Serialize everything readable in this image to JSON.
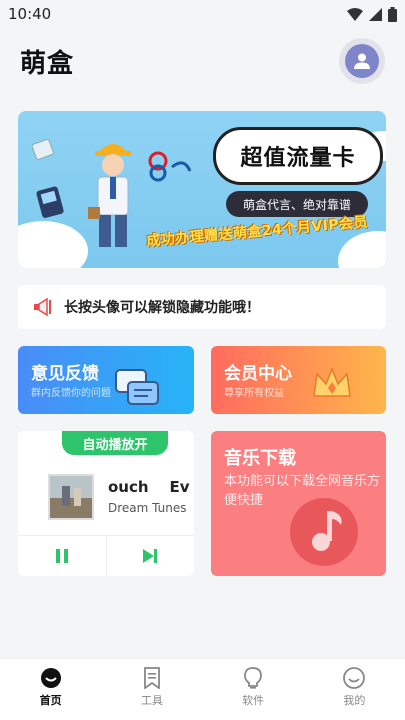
{
  "status": {
    "time": "10:40",
    "icons": [
      "wifi-icon",
      "signal-icon",
      "battery-icon"
    ]
  },
  "header": {
    "title": "萌盒",
    "avatar_icon": "person-icon"
  },
  "banner": {
    "title": "超值流量卡",
    "subtitle": "萌盒代言、绝对靠谱",
    "promo": "成功办理赠送萌盒24个月VIP会员"
  },
  "notice": {
    "icon": "megaphone-icon",
    "text": "长按头像可以解锁隐藏功能哦！"
  },
  "cards": {
    "feedback": {
      "title": "意见反馈",
      "subtitle": "群内反馈你的问题",
      "icon": "chat-bubbles-icon"
    },
    "vip": {
      "title": "会员中心",
      "subtitle": "尊享所有权益",
      "icon": "crown-icon"
    },
    "player": {
      "autoplay_label": "自动播放开",
      "song_title": "ouch    Ev",
      "artist": "Dream Tunes",
      "pause_icon": "pause-icon",
      "next_icon": "skip-next-icon"
    },
    "music": {
      "title": "音乐下载",
      "description": "本功能可以下载全网音乐方便快捷",
      "icon": "music-note-icon"
    }
  },
  "tabbar": {
    "active_color": "#111111",
    "tabs": [
      {
        "label": "首页",
        "icon": "home-icon",
        "active": true
      },
      {
        "label": "工具",
        "icon": "bookmark-icon",
        "active": false
      },
      {
        "label": "软件",
        "icon": "lightbulb-icon",
        "active": false
      },
      {
        "label": "我的",
        "icon": "smiley-icon",
        "active": false
      }
    ]
  },
  "colors": {
    "feedback": "#3a9df7",
    "vip": "#ff8a55",
    "music": "#fb7f80",
    "autoplay": "#2ec46b"
  }
}
